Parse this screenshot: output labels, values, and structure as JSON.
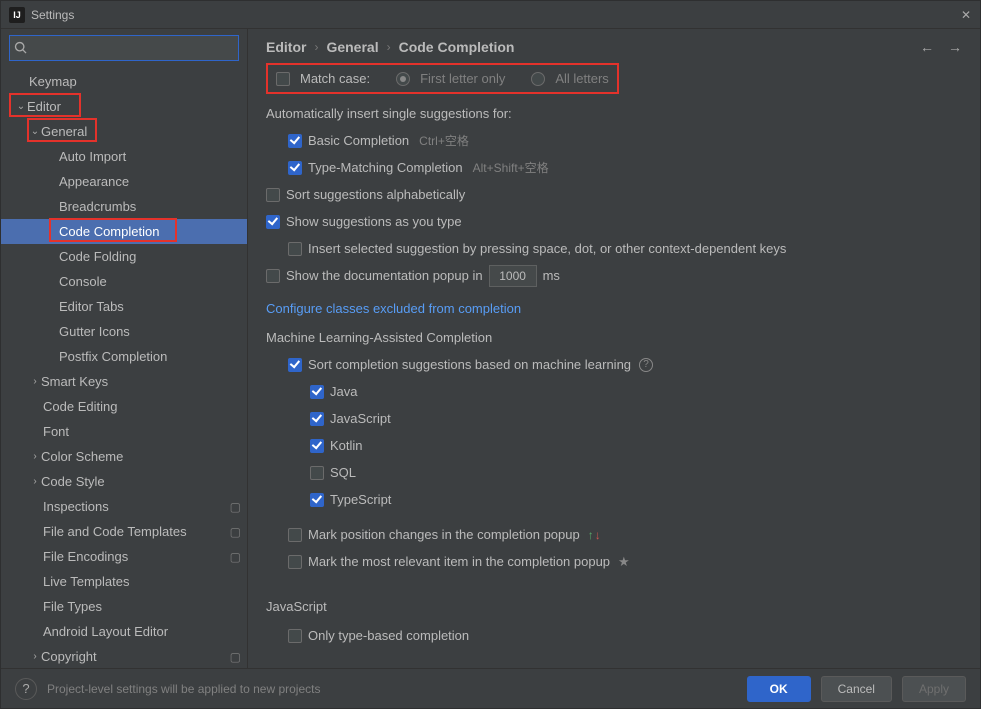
{
  "title": "Settings",
  "search": {
    "placeholder": "",
    "value": ""
  },
  "tree": {
    "keymap": "Keymap",
    "editor": "Editor",
    "general": "General",
    "auto_import": "Auto Import",
    "appearance": "Appearance",
    "breadcrumbs": "Breadcrumbs",
    "code_completion": "Code Completion",
    "code_folding": "Code Folding",
    "console": "Console",
    "editor_tabs": "Editor Tabs",
    "gutter_icons": "Gutter Icons",
    "postfix_completion": "Postfix Completion",
    "smart_keys": "Smart Keys",
    "code_editing": "Code Editing",
    "font": "Font",
    "color_scheme": "Color Scheme",
    "code_style": "Code Style",
    "inspections": "Inspections",
    "file_code_templates": "File and Code Templates",
    "file_encodings": "File Encodings",
    "live_templates": "Live Templates",
    "file_types": "File Types",
    "android_layout_editor": "Android Layout Editor",
    "copyright": "Copyright"
  },
  "breadcrumb": {
    "c1": "Editor",
    "c2": "General",
    "c3": "Code Completion"
  },
  "match_case": {
    "label": "Match case:",
    "opt_first": "First letter only",
    "opt_all": "All letters"
  },
  "auto_insert_heading": "Automatically insert single suggestions for:",
  "basic_completion": {
    "label": "Basic Completion",
    "shortcut": "Ctrl+空格"
  },
  "type_matching": {
    "label": "Type-Matching Completion",
    "shortcut": "Alt+Shift+空格"
  },
  "sort_alpha": "Sort suggestions alphabetically",
  "show_as_type": "Show suggestions as you type",
  "insert_selected": "Insert selected suggestion by pressing space, dot, or other context-dependent keys",
  "show_doc_popup": {
    "prefix": "Show the documentation popup in",
    "value": "1000",
    "suffix": "ms"
  },
  "configure_link": "Configure classes excluded from completion",
  "ml_heading": "Machine Learning-Assisted Completion",
  "ml_sort": "Sort completion suggestions based on machine learning",
  "langs": {
    "java": "Java",
    "javascript": "JavaScript",
    "kotlin": "Kotlin",
    "sql": "SQL",
    "typescript": "TypeScript"
  },
  "mark_position": "Mark position changes in the completion popup",
  "mark_relevant": "Mark the most relevant item in the completion popup",
  "js_heading": "JavaScript",
  "only_type_based": "Only type-based completion",
  "footer": {
    "hint": "Project-level settings will be applied to new projects",
    "ok": "OK",
    "cancel": "Cancel",
    "apply": "Apply"
  }
}
